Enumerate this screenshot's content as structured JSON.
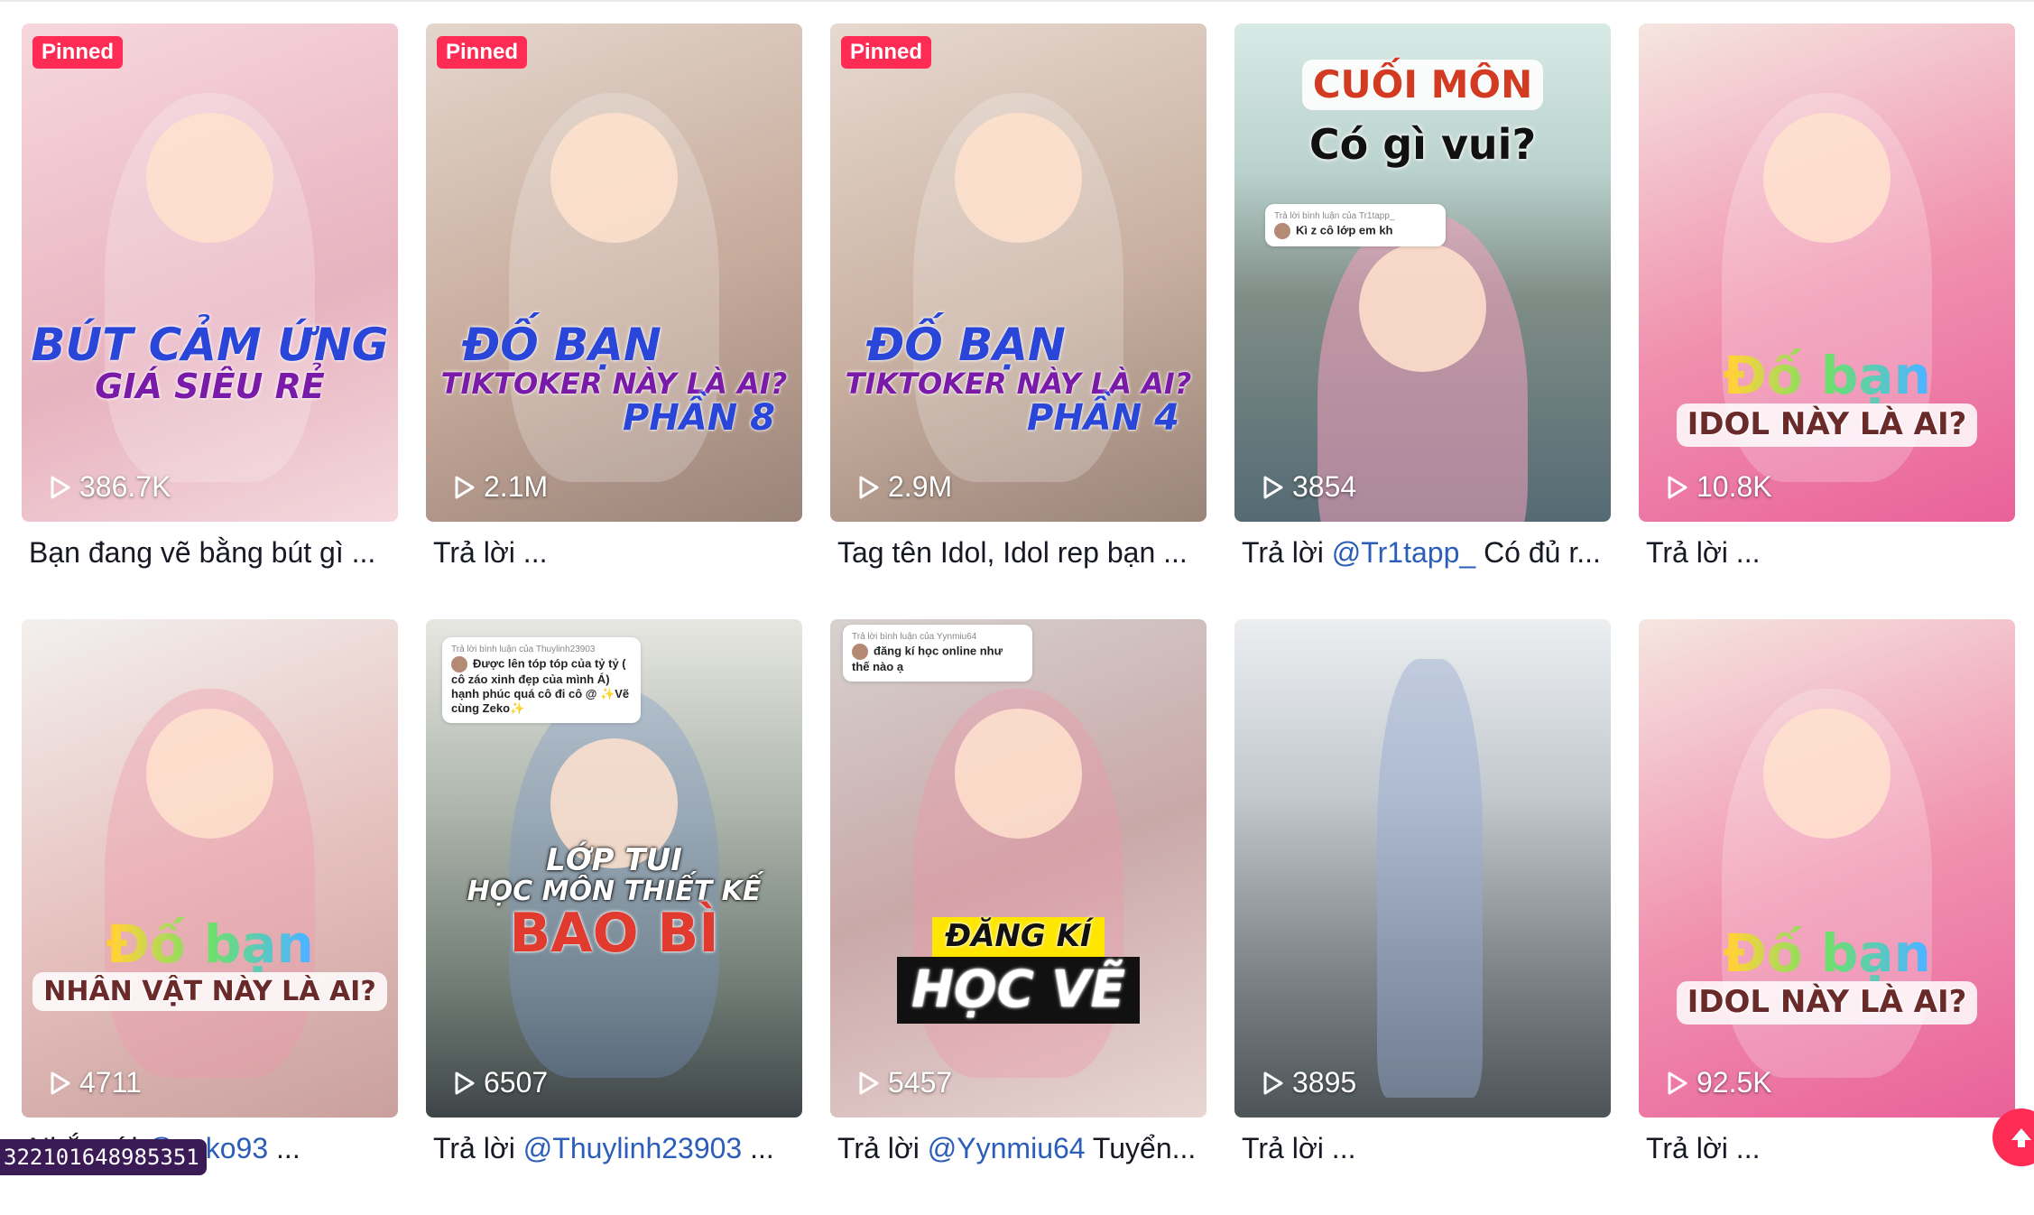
{
  "videos": [
    {
      "pinned": "Pinned",
      "views": "386.7K",
      "caption_text": "Bạn đang vẽ bằng bút gì ...",
      "caption_mention": "",
      "caption_rest": "",
      "overlay_lines": [
        "BÚT CẢM ỨNG",
        "GIÁ SIÊU RẺ"
      ],
      "bg": "#f2c6d2"
    },
    {
      "pinned": "Pinned",
      "views": "2.1M",
      "caption_text": "Trả lời ...",
      "caption_mention": "",
      "caption_rest": "",
      "overlay_lines": [
        "ĐỐ BẠN",
        "TIKTOKER NÀY LÀ AI?",
        "PHẦN 8"
      ],
      "bg": "#d6c2b5"
    },
    {
      "pinned": "Pinned",
      "views": "2.9M",
      "caption_text": "Tag tên Idol, Idol rep bạn ...",
      "caption_mention": "",
      "caption_rest": "",
      "overlay_lines": [
        "ĐỐ BẠN",
        "TIKTOKER NÀY LÀ AI?",
        "PHẦN 4"
      ],
      "bg": "#d8c6b9"
    },
    {
      "pinned": "",
      "views": "3854",
      "caption_text": "Trả lời ",
      "caption_mention": "@Tr1tapp_",
      "caption_rest": " Có đủ r...",
      "overlay_lines": [
        "CUỐI MÔN",
        "Có gì vui?"
      ],
      "comment_head": "Trả lời bình luận của Tr1tapp_",
      "comment_body": "Kì z cô lớp em kh",
      "bg": "#9fb7b2"
    },
    {
      "pinned": "",
      "views": "10.8K",
      "caption_text": "Trả lời ...",
      "caption_mention": "",
      "caption_rest": "",
      "overlay_lines": [
        "Đố bạn",
        "IDOL NÀY LÀ AI?"
      ],
      "bg": "#ec8fa9"
    },
    {
      "pinned": "",
      "views": "4711",
      "caption_text": "Nhắc tới ",
      "caption_mention": "@zeko93",
      "caption_rest": " ...",
      "overlay_lines": [
        "Đố bạn",
        "NHÂN VẬT NÀY LÀ AI?"
      ],
      "bg": "#e9c7c2"
    },
    {
      "pinned": "",
      "views": "6507",
      "caption_text": "Trả lời ",
      "caption_mention": "@Thuylinh23903",
      "caption_rest": " ...",
      "overlay_lines": [
        "LỚP TUI",
        "HỌC MÔN THIẾT KẾ",
        "BAO BÌ"
      ],
      "comment_head": "Trả lời bình luận của Thuylinh23903",
      "comment_body": "Được lên tóp tóp của tỷ tỷ ( cô záo xinh đẹp của mình Á) hạnh phúc quá cô đi cô @ ✨Vẽ cùng Zeko✨",
      "bg": "#8d9a8f"
    },
    {
      "pinned": "",
      "views": "5457",
      "caption_text": "Trả lời ",
      "caption_mention": "@Yynmiu64",
      "caption_rest": " Tuyển...",
      "overlay_lines": [
        "ĐĂNG KÍ",
        "HỌC VẼ"
      ],
      "comment_head": "Trả lời bình luận của Yynmiu64",
      "comment_body": "đăng kí học online như thế nào ạ",
      "bg": "#c9b2ae"
    },
    {
      "pinned": "",
      "views": "3895",
      "caption_text": "Trả lời ...",
      "caption_mention": "",
      "caption_rest": "",
      "overlay_lines": [],
      "bg": "#a7b0b6"
    },
    {
      "pinned": "",
      "views": "92.5K",
      "caption_text": "Trả lời ...",
      "caption_mention": "",
      "caption_rest": "",
      "overlay_lines": [
        "Đố bạn",
        "IDOL NÀY LÀ AI?"
      ],
      "bg": "#ec8fa9"
    }
  ],
  "tooltip_id": "322101648985351",
  "colors": {
    "pinned_badge": "#fe2c55",
    "mention": "#2b5db9",
    "caption_text": "#161823",
    "tooltip_bg": "#3b1b55"
  },
  "icons": {
    "views": "play-outline-icon",
    "fab": "scroll-top-icon"
  }
}
